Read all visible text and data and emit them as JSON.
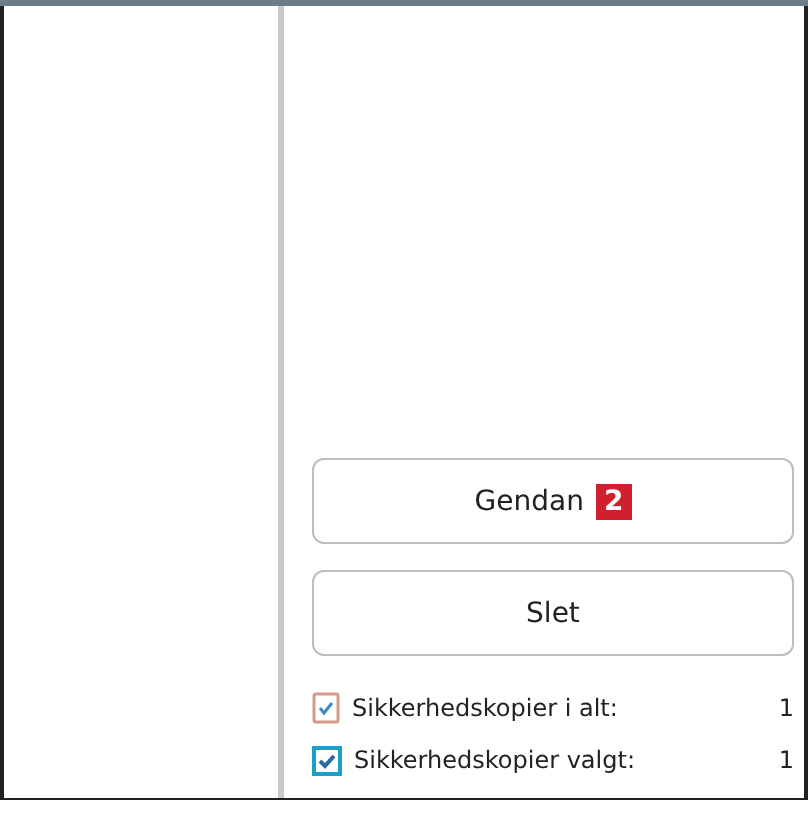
{
  "buttons": [
    {
      "label": "Gendan",
      "badge": "2"
    },
    {
      "label": "Slet"
    }
  ],
  "summary": [
    {
      "kind": "counter",
      "label": "Sikkerhedskopier i alt:",
      "value": "1"
    },
    {
      "kind": "checkbox",
      "checked": true,
      "label": "Sikkerhedskopier valgt:",
      "value": "1"
    }
  ]
}
